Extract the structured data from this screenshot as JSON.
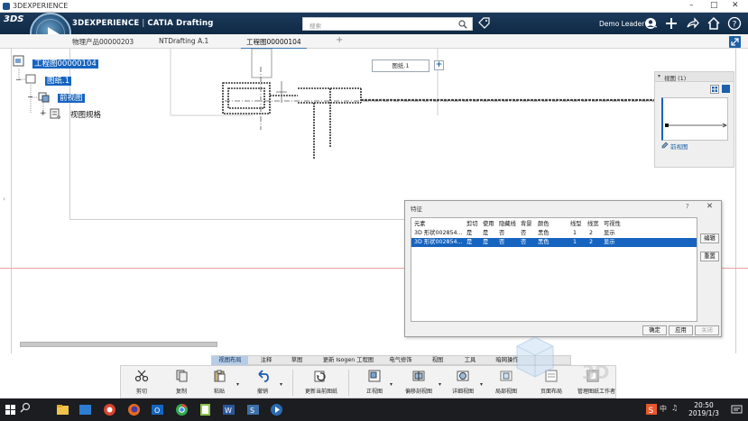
{
  "window": {
    "title": "3DEXPERIENCE"
  },
  "header": {
    "brand_left": "3DEXPERIENCE",
    "brand_sep": " | ",
    "brand_right": "CATIA Drafting",
    "search_placeholder": "搜索",
    "user_name": "Demo Leader"
  },
  "tabs": [
    {
      "label": "物理产品00000203",
      "active": false
    },
    {
      "label": "NTDrafting A.1",
      "active": false
    },
    {
      "label": "工程图00000104",
      "active": true
    }
  ],
  "tree": {
    "root": "工程图00000104",
    "sheet": "图纸.1",
    "view": "前视图",
    "view_spec": "视图规格"
  },
  "canvas": {
    "sheet_label": "图纸.1"
  },
  "view_panel": {
    "title": "视图 (1)",
    "thumb_label": "前视图"
  },
  "feature_dialog": {
    "title": "特征",
    "help": "?",
    "columns": [
      "元素",
      "剪切",
      "使用",
      "隐藏线",
      "背景",
      "颜色",
      "线型",
      "线宽",
      "可视性"
    ],
    "rows": [
      [
        "3D 形状002854...",
        "是",
        "是",
        "否",
        "否",
        "黑色",
        "1",
        "2",
        "显示"
      ],
      [
        "3D 形状002854...",
        "是",
        "是",
        "否",
        "否",
        "黑色",
        "1",
        "2",
        "显示"
      ]
    ],
    "selected_row": 1,
    "side_buttons": {
      "edit": "编辑",
      "reset": "重置"
    },
    "bottom_buttons": {
      "ok": "确定",
      "apply": "应用",
      "close": "关闭"
    }
  },
  "ribbon": {
    "tabs": [
      {
        "label": "视图布局",
        "active": true
      },
      {
        "label": "注释",
        "active": false
      },
      {
        "label": "草图",
        "active": false
      },
      {
        "label": "更新 Isogen 工程图",
        "active": false
      },
      {
        "label": "电气修饰",
        "active": false
      },
      {
        "label": "视图",
        "active": false
      },
      {
        "label": "工具",
        "active": false
      },
      {
        "label": "暗网操作",
        "active": false
      }
    ],
    "tools": {
      "cut": "剪切",
      "copy": "复制",
      "paste": "粘贴",
      "undo": "撤销",
      "update_current_sheet": "更新当前图纸",
      "front_view": "正视图",
      "offset_section": "偏移剖视图",
      "detail_view": "详细视图",
      "clipping_view": "局部视图",
      "page_layout": "页面布局",
      "manage_background": "管理图纸工作者"
    }
  },
  "taskbar": {
    "time": "20:50",
    "date": "2019/1/3",
    "ime": "中"
  },
  "colors": {
    "selection": "#1664c0",
    "header_bg": "#0f2944",
    "accent": "#3b77b5"
  }
}
